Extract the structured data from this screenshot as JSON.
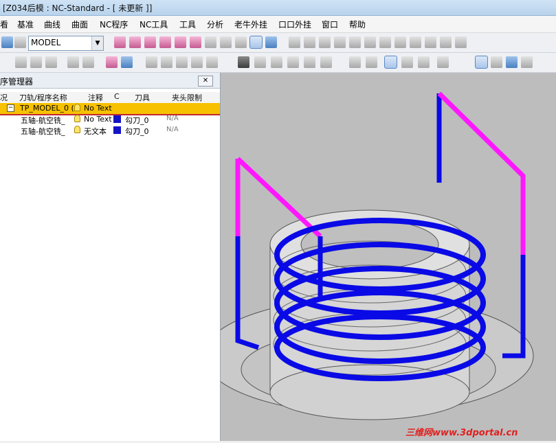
{
  "window": {
    "title": "[Z034后模 : NC-Standard - [ 未更新 ]]"
  },
  "menu": [
    "看",
    "基准",
    "曲线",
    "曲面",
    "NC程序",
    "NC工具",
    "工具",
    "分析",
    "老牛外挂",
    "口口外挂",
    "窗口",
    "帮助"
  ],
  "toolbar": {
    "model_combo_value": "MODEL"
  },
  "panel": {
    "title": "序管理器",
    "close_label": "✕",
    "columns": [
      "况",
      "刀轨/程序名称",
      "注释",
      "C",
      "刀具",
      "夹头限制"
    ],
    "rows": [
      {
        "expander": "−",
        "name": "TP_MODEL_0 (",
        "note": "No Text",
        "tool": "",
        "limit": ""
      },
      {
        "name": "五轴-航空铣_",
        "note": "No Text",
        "tool": "勾刀_0",
        "limit": "N/A"
      },
      {
        "name": "五轴-航空铣_",
        "note": "无文本",
        "tool": "勾刀_0",
        "limit": "N/A"
      }
    ]
  },
  "viewport": {
    "background": "#bdbdbd",
    "toolpath_blue": "#0a0ae6",
    "toolpath_magenta": "#ff18ff"
  },
  "watermark": "三维网www.3dportal.cn",
  "icons": {
    "toolbar1": [
      "undo-icon",
      "redo-icon",
      "layer-icon",
      "cursor-icon",
      "curve-icon",
      "surface-icon",
      "mirror-icon",
      "trim-icon",
      "offset-icon",
      "project-icon",
      "plane-icon",
      "sketch-icon",
      "snap-icon",
      "line-icon",
      "arc-icon",
      "circle-icon",
      "spline-icon",
      "point-icon",
      "cut-icon",
      "align-icon",
      "extend-icon",
      "fillet-icon",
      "chamfer-icon",
      "measure-icon",
      "analyze-icon"
    ],
    "toolbar2": [
      "hide-icon",
      "table-icon",
      "dimension-icon",
      "copy-icon",
      "stack-icon",
      "filter-icon",
      "zoom-fit-icon",
      "zoom-window-icon",
      "zoom-icon",
      "pan-icon",
      "rotate-icon",
      "shaded-icon",
      "view-front-icon",
      "view-back-icon",
      "view-top-icon",
      "view-left-icon",
      "view-right-icon",
      "view-iso-icon",
      "tool-icon",
      "section-icon",
      "wireframe-icon",
      "hidden-line-icon",
      "render-icon",
      "display-icon",
      "print-icon",
      "list-icon",
      "report-icon",
      "export-icon"
    ]
  }
}
